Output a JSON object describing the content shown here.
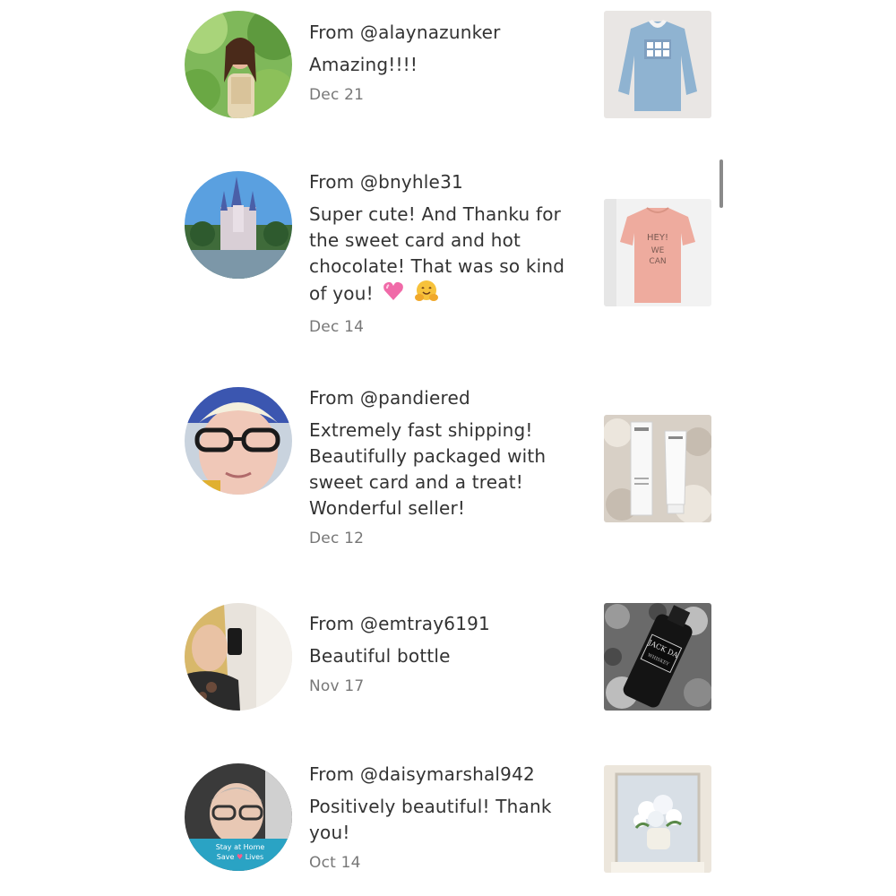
{
  "reviews": [
    {
      "from_prefix": "From",
      "handle": "@alaynazunker",
      "text": "Amazing!!!!",
      "date": "Dec 21",
      "avatar_icon": "woman-in-garden-photo",
      "thumb_icon": "blue-sweatshirt-photo"
    },
    {
      "from_prefix": "From",
      "handle": "@bnyhle31",
      "text": "Super cute! And Thanku for the sweet card and hot chocolate! That was so kind of you!",
      "emojis": [
        "pink-heart-emoji",
        "hugging-face-emoji"
      ],
      "date": "Dec 14",
      "avatar_icon": "castle-photo",
      "thumb_icon": "pink-tshirt-photo"
    },
    {
      "from_prefix": "From",
      "handle": "@pandiered",
      "text": "Extremely fast shipping! Beautifully packaged with sweet card and a treat! Wonderful seller!",
      "date": "Dec 12",
      "avatar_icon": "woman-with-glasses-photo",
      "thumb_icon": "skincare-tubes-photo"
    },
    {
      "from_prefix": "From",
      "handle": "@emtray6191",
      "text": "Beautiful bottle",
      "date": "Nov 17",
      "avatar_icon": "mirror-selfie-photo",
      "thumb_icon": "black-bottle-photo"
    },
    {
      "from_prefix": "From",
      "handle": "@daisymarshal942",
      "text": "Positively beautiful! Thank you!",
      "date": "Oct 14",
      "avatar_icon": "stay-at-home-avatar-photo",
      "avatar_overlay_lines": [
        "Stay at Home",
        "Save",
        "Lives"
      ],
      "thumb_icon": "flower-painting-photo"
    }
  ],
  "colors": {
    "text_primary": "#333333",
    "text_secondary": "#777777",
    "background": "#ffffff",
    "scrollbar": "#8a8a8a"
  }
}
